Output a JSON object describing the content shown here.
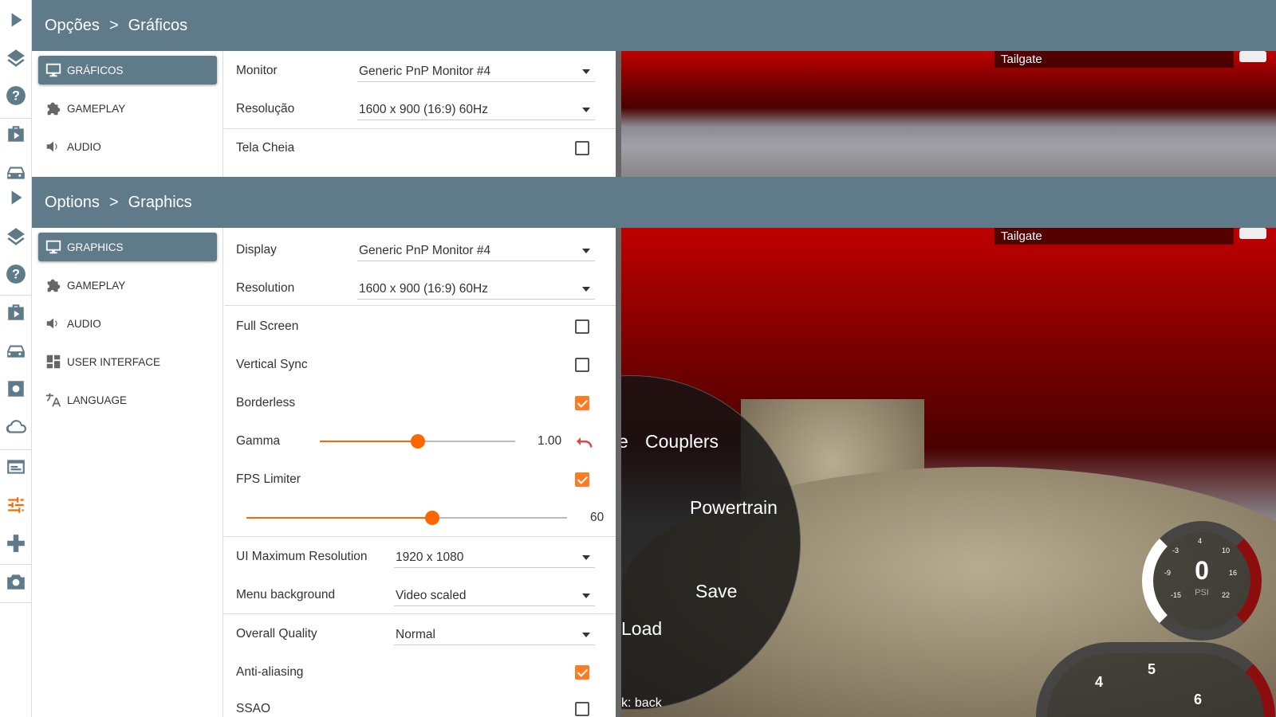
{
  "top": {
    "breadcrumb": [
      "Opções",
      ">",
      "Gráficos"
    ],
    "sidebar": [
      {
        "label": "GRÁFICOS",
        "icon": "monitor-icon"
      },
      {
        "label": "GAMEPLAY",
        "icon": "puzzle-icon"
      },
      {
        "label": "AUDIO",
        "icon": "speaker-icon"
      }
    ],
    "settings": {
      "monitor_label": "Monitor",
      "monitor_value": "Generic PnP Monitor #4",
      "resolution_label": "Resolução",
      "resolution_value": "1600 x 900 (16:9) 60Hz",
      "fullscreen_label": "Tela Cheia",
      "fullscreen": false
    },
    "game": {
      "tag": "Tailgate"
    }
  },
  "main": {
    "breadcrumb": [
      "Options",
      ">",
      "Graphics"
    ],
    "sidebar": [
      {
        "label": "GRAPHICS",
        "icon": "monitor-icon"
      },
      {
        "label": "GAMEPLAY",
        "icon": "puzzle-icon"
      },
      {
        "label": "AUDIO",
        "icon": "speaker-icon"
      },
      {
        "label": "USER INTERFACE",
        "icon": "dashboard-icon"
      },
      {
        "label": "LANGUAGE",
        "icon": "translate-icon"
      }
    ],
    "settings": {
      "display_label": "Display",
      "display_value": "Generic PnP Monitor #4",
      "resolution_label": "Resolution",
      "resolution_value": "1600 x 900 (16:9) 60Hz",
      "fullscreen_label": "Full Screen",
      "fullscreen": false,
      "vsync_label": "Vertical Sync",
      "vsync": false,
      "borderless_label": "Borderless",
      "borderless": true,
      "gamma_label": "Gamma",
      "gamma_value": "1.00",
      "gamma_fraction": 0.5,
      "fps_label": "FPS Limiter",
      "fps_enabled": true,
      "fps_value": "60",
      "fps_fraction": 0.58,
      "ui_res_label": "UI Maximum Resolution",
      "ui_res_value": "1920 x 1080",
      "menu_bg_label": "Menu background",
      "menu_bg_value": "Video scaled",
      "quality_label": "Overall Quality",
      "quality_value": "Normal",
      "aa_label": "Anti-aliasing",
      "aa": true,
      "ssao_label": "SSAO",
      "ssao": false
    },
    "game": {
      "tag": "Tailgate",
      "radial": [
        "e",
        "Couplers",
        "Powertrain",
        "Save",
        "Load"
      ],
      "hint": "k: back",
      "gauge": {
        "value": "0",
        "unit": "PSI",
        "ticks": [
          "4",
          "10",
          "16",
          "22",
          "-3",
          "-9",
          "-15"
        ]
      },
      "tach": [
        "4",
        "5",
        "6"
      ]
    }
  },
  "colors": {
    "accent": "#ff6600",
    "header": "#5f7a89"
  }
}
